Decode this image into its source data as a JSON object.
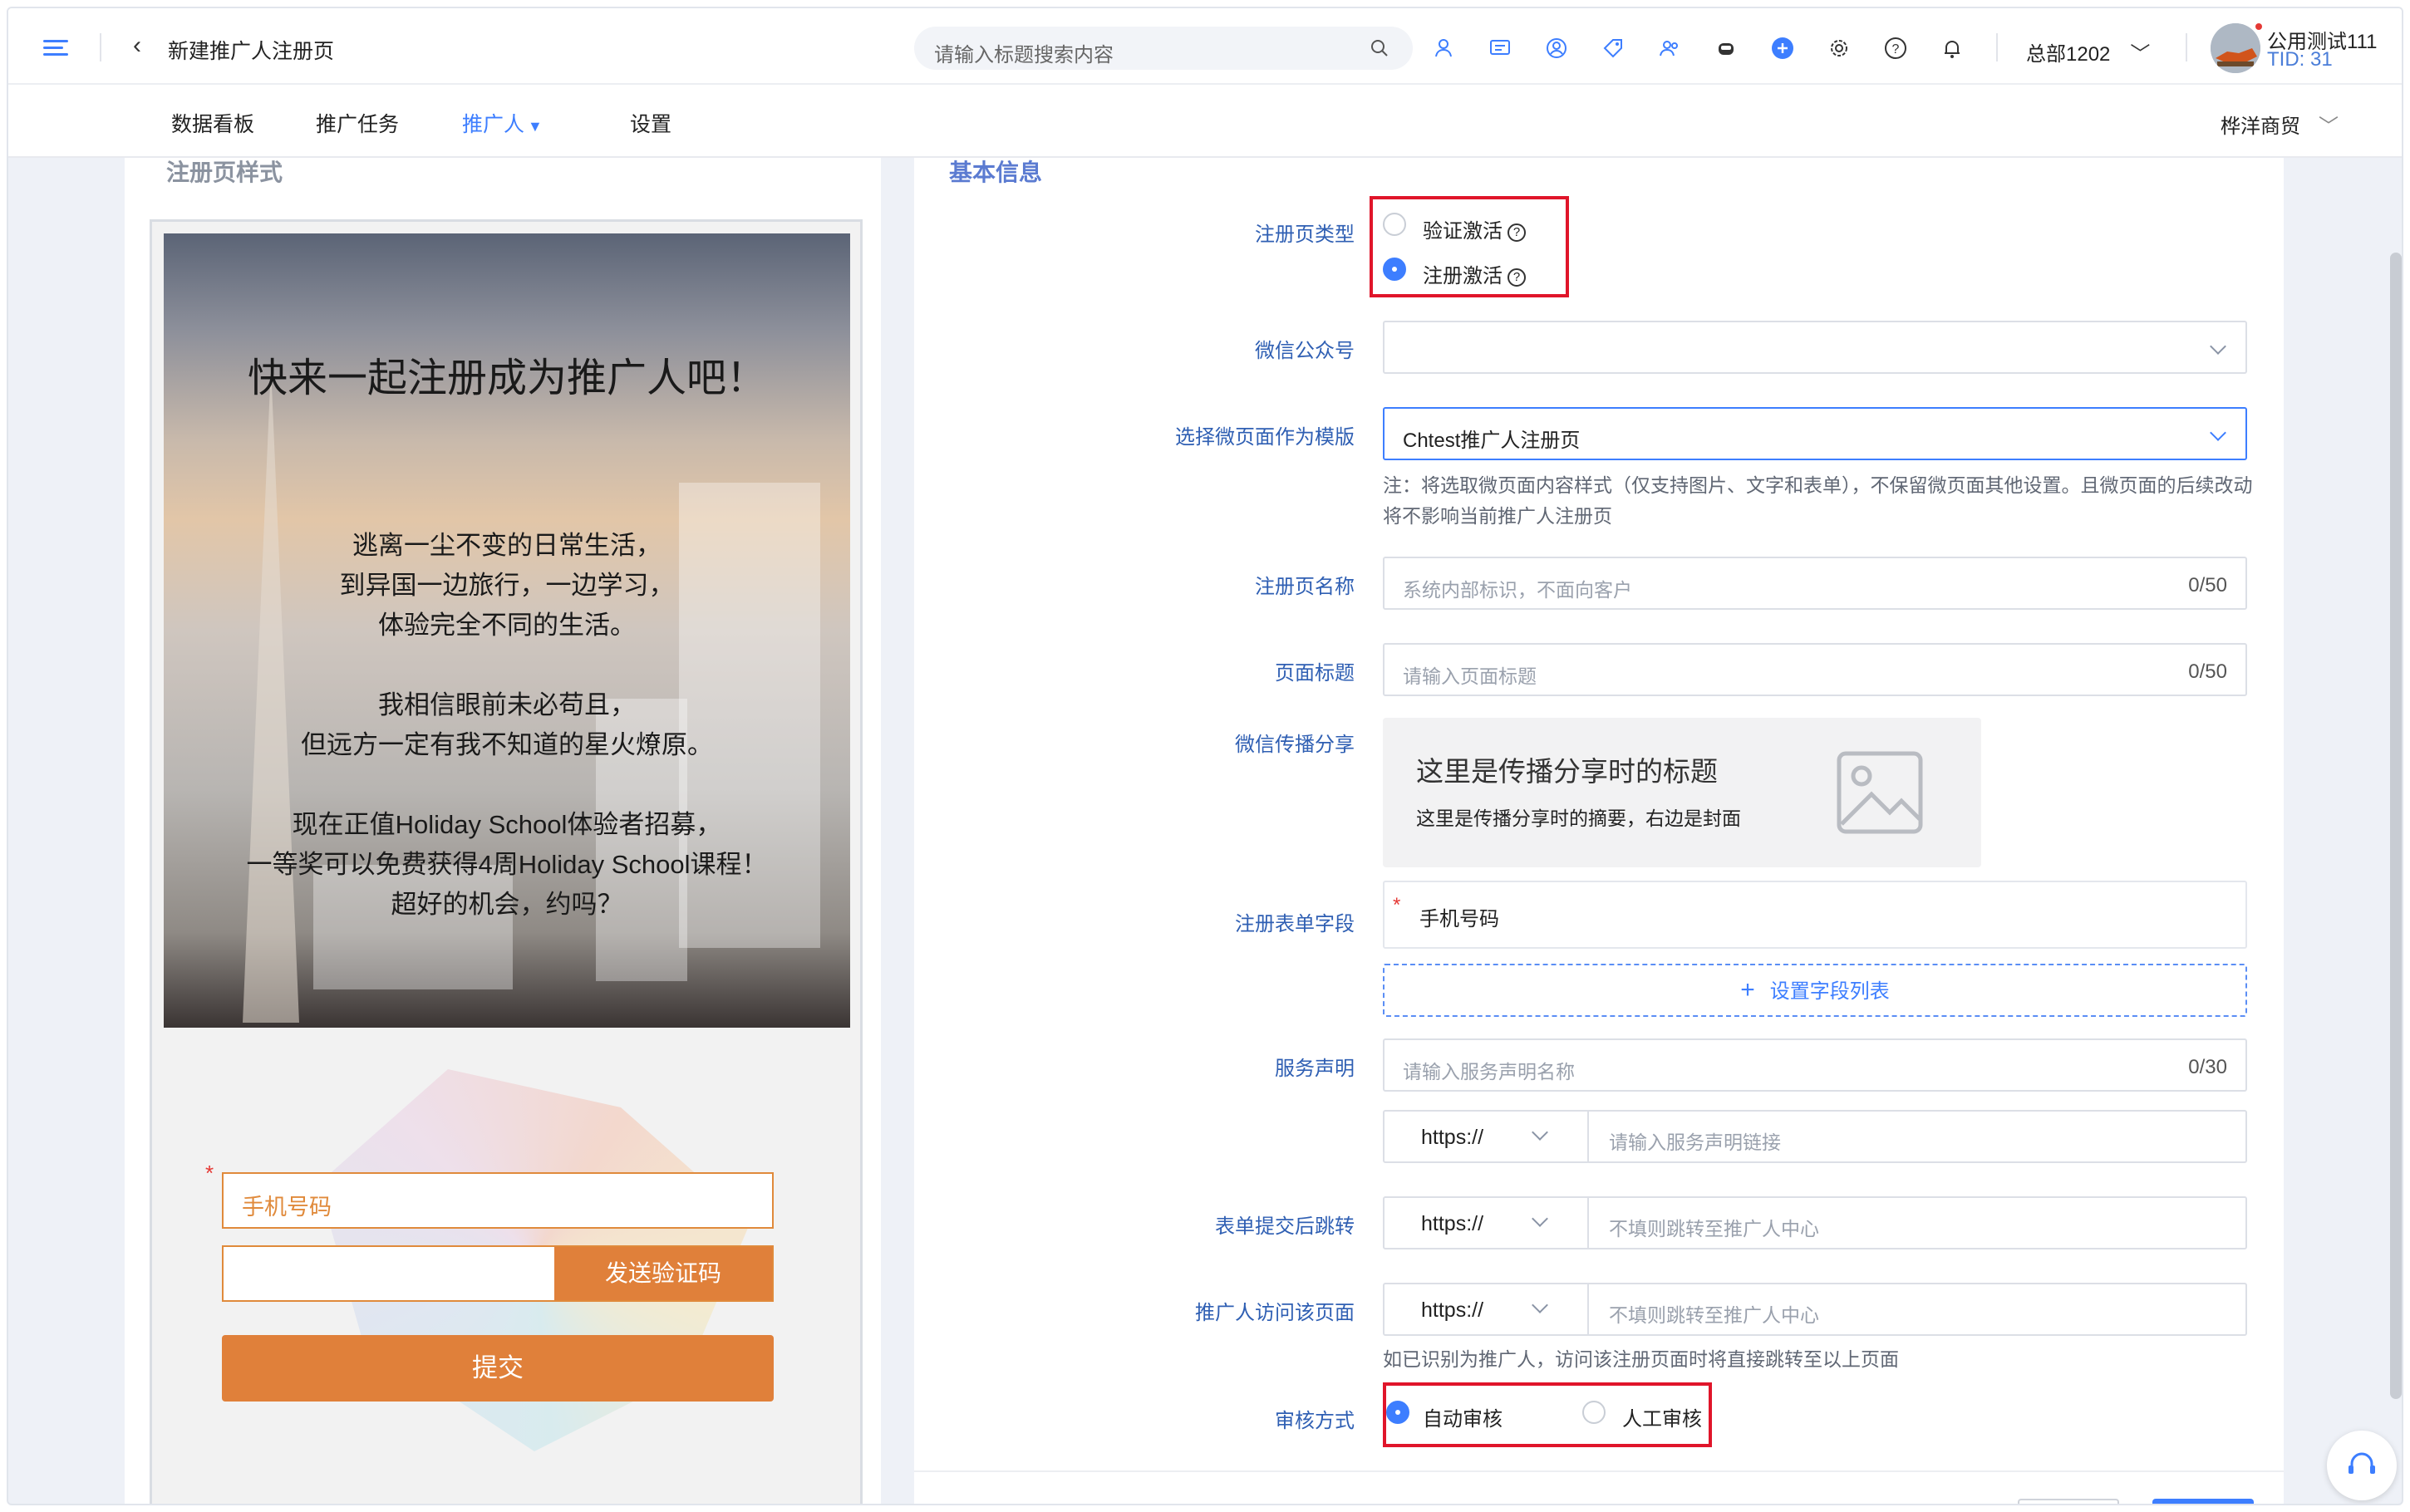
{
  "header": {
    "page_title": "新建推广人注册页",
    "search_placeholder": "请输入标题搜索内容",
    "tenant": "总部1202",
    "user_name": "公用测试111",
    "user_tid": "TID: 31"
  },
  "nav": {
    "items": [
      "数据看板",
      "推广任务",
      "推广人",
      "设置"
    ],
    "active": "推广人",
    "company": "桦洋商贸"
  },
  "preview": {
    "section_title": "注册页样式",
    "hero_title": "快来一起注册成为推广人吧！",
    "hero_lines": [
      "逃离一尘不变的日常生活，",
      "到异国一边旅行，一边学习，",
      "体验完全不同的生活。",
      "",
      "我相信眼前未必苟且，",
      "但远方一定有我不知道的星火燎原。",
      "",
      "现在正值Holiday School体验者招募，",
      "一等奖可以免费获得4周Holiday School课程！",
      "超好的机会，约吗？"
    ],
    "phone_field": "手机号码",
    "send_code_button": "发送验证码",
    "submit_button": "提交"
  },
  "form": {
    "section_title": "基本信息",
    "type_label": "注册页类型",
    "type_option_1": "验证激活",
    "type_option_2": "注册激活",
    "type_selected": "注册激活",
    "wechat_label": "微信公众号",
    "wechat_value": "",
    "template_label": "选择微页面作为模版",
    "template_value": "Chtest推广人注册页",
    "template_note": "注：将选取微页面内容样式（仅支持图片、文字和表单），不保留微页面其他设置。且微页面的后续改动将不影响当前推广人注册页",
    "name_label": "注册页名称",
    "name_placeholder": "系统内部标识，不面向客户",
    "name_count": "0/50",
    "title_label": "页面标题",
    "title_placeholder": "请输入页面标题",
    "title_count": "0/50",
    "share_label": "微信传播分享",
    "share_title": "这里是传播分享时的标题",
    "share_summary": "这里是传播分享时的摘要，右边是封面",
    "fields_label": "注册表单字段",
    "field_1": "手机号码",
    "set_fields_button": "设置字段列表",
    "service_label": "服务声明",
    "service_name_placeholder": "请输入服务声明名称",
    "service_count": "0/30",
    "protocol": "https://",
    "service_link_placeholder": "请输入服务声明链接",
    "redirect_label": "表单提交后跳转",
    "redirect_placeholder": "不填则跳转至推广人中心",
    "visit_label": "推广人访问该页面",
    "visit_placeholder": "不填则跳转至推广人中心",
    "visit_note": "如已识别为推广人，访问该注册页面时将直接跳转至以上页面",
    "review_label": "审核方式",
    "review_option_1": "自动审核",
    "review_option_2": "人工审核",
    "review_selected": "自动审核"
  },
  "colors": {
    "accent": "#3d7eff",
    "label": "#2f5fb3",
    "orange": "#e0803a",
    "highlight": "#e0152a"
  }
}
